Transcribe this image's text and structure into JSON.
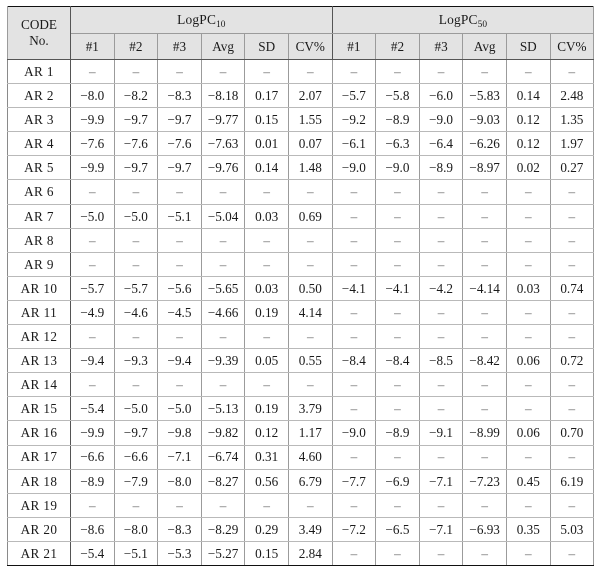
{
  "table": {
    "code_header": {
      "line1": "CODE",
      "line2": "No."
    },
    "groups": [
      {
        "label_main": "LogPC",
        "label_sub": "10"
      },
      {
        "label_main": "LogPC",
        "label_sub": "50"
      }
    ],
    "sub_headers": [
      "#1",
      "#2",
      "#3",
      "Avg",
      "SD",
      "CV%"
    ],
    "empty_marker": "–",
    "rows": [
      {
        "code": "AR 1",
        "pc10": [
          "–",
          "–",
          "–",
          "–",
          "–",
          "–"
        ],
        "pc50": [
          "–",
          "–",
          "–",
          "–",
          "–",
          "–"
        ]
      },
      {
        "code": "AR 2",
        "pc10": [
          "−8.0",
          "−8.2",
          "−8.3",
          "−8.18",
          "0.17",
          "2.07"
        ],
        "pc50": [
          "−5.7",
          "−5.8",
          "−6.0",
          "−5.83",
          "0.14",
          "2.48"
        ]
      },
      {
        "code": "AR 3",
        "pc10": [
          "−9.9",
          "−9.7",
          "−9.7",
          "−9.77",
          "0.15",
          "1.55"
        ],
        "pc50": [
          "−9.2",
          "−8.9",
          "−9.0",
          "−9.03",
          "0.12",
          "1.35"
        ]
      },
      {
        "code": "AR 4",
        "pc10": [
          "−7.6",
          "−7.6",
          "−7.6",
          "−7.63",
          "0.01",
          "0.07"
        ],
        "pc50": [
          "−6.1",
          "−6.3",
          "−6.4",
          "−6.26",
          "0.12",
          "1.97"
        ]
      },
      {
        "code": "AR 5",
        "pc10": [
          "−9.9",
          "−9.7",
          "−9.7",
          "−9.76",
          "0.14",
          "1.48"
        ],
        "pc50": [
          "−9.0",
          "−9.0",
          "−8.9",
          "−8.97",
          "0.02",
          "0.27"
        ]
      },
      {
        "code": "AR 6",
        "pc10": [
          "–",
          "–",
          "–",
          "–",
          "–",
          "–"
        ],
        "pc50": [
          "–",
          "–",
          "–",
          "–",
          "–",
          "–"
        ]
      },
      {
        "code": "AR 7",
        "pc10": [
          "−5.0",
          "−5.0",
          "−5.1",
          "−5.04",
          "0.03",
          "0.69"
        ],
        "pc50": [
          "–",
          "–",
          "–",
          "–",
          "–",
          "–"
        ]
      },
      {
        "code": "AR 8",
        "pc10": [
          "–",
          "–",
          "–",
          "–",
          "–",
          "–"
        ],
        "pc50": [
          "–",
          "–",
          "–",
          "–",
          "–",
          "–"
        ]
      },
      {
        "code": "AR 9",
        "pc10": [
          "–",
          "–",
          "–",
          "–",
          "–",
          "–"
        ],
        "pc50": [
          "–",
          "–",
          "–",
          "–",
          "–",
          "–"
        ]
      },
      {
        "code": "AR 10",
        "pc10": [
          "−5.7",
          "−5.7",
          "−5.6",
          "−5.65",
          "0.03",
          "0.50"
        ],
        "pc50": [
          "−4.1",
          "−4.1",
          "−4.2",
          "−4.14",
          "0.03",
          "0.74"
        ]
      },
      {
        "code": "AR 11",
        "pc10": [
          "−4.9",
          "−4.6",
          "−4.5",
          "−4.66",
          "0.19",
          "4.14"
        ],
        "pc50": [
          "–",
          "–",
          "–",
          "–",
          "–",
          "–"
        ]
      },
      {
        "code": "AR 12",
        "pc10": [
          "–",
          "–",
          "–",
          "–",
          "–",
          "–"
        ],
        "pc50": [
          "–",
          "–",
          "–",
          "–",
          "–",
          "–"
        ]
      },
      {
        "code": "AR 13",
        "pc10": [
          "−9.4",
          "−9.3",
          "−9.4",
          "−9.39",
          "0.05",
          "0.55"
        ],
        "pc50": [
          "−8.4",
          "−8.4",
          "−8.5",
          "−8.42",
          "0.06",
          "0.72"
        ]
      },
      {
        "code": "AR 14",
        "pc10": [
          "–",
          "–",
          "–",
          "–",
          "–",
          "–"
        ],
        "pc50": [
          "–",
          "–",
          "–",
          "–",
          "–",
          "–"
        ]
      },
      {
        "code": "AR 15",
        "pc10": [
          "−5.4",
          "−5.0",
          "−5.0",
          "−5.13",
          "0.19",
          "3.79"
        ],
        "pc50": [
          "–",
          "–",
          "–",
          "–",
          "–",
          "–"
        ]
      },
      {
        "code": "AR 16",
        "pc10": [
          "−9.9",
          "−9.7",
          "−9.8",
          "−9.82",
          "0.12",
          "1.17"
        ],
        "pc50": [
          "−9.0",
          "−8.9",
          "−9.1",
          "−8.99",
          "0.06",
          "0.70"
        ]
      },
      {
        "code": "AR 17",
        "pc10": [
          "−6.6",
          "−6.6",
          "−7.1",
          "−6.74",
          "0.31",
          "4.60"
        ],
        "pc50": [
          "–",
          "–",
          "–",
          "–",
          "–",
          "–"
        ]
      },
      {
        "code": "AR 18",
        "pc10": [
          "−8.9",
          "−7.9",
          "−8.0",
          "−8.27",
          "0.56",
          "6.79"
        ],
        "pc50": [
          "−7.7",
          "−6.9",
          "−7.1",
          "−7.23",
          "0.45",
          "6.19"
        ]
      },
      {
        "code": "AR 19",
        "pc10": [
          "–",
          "–",
          "–",
          "–",
          "–",
          "–"
        ],
        "pc50": [
          "–",
          "–",
          "–",
          "–",
          "–",
          "–"
        ]
      },
      {
        "code": "AR 20",
        "pc10": [
          "−8.6",
          "−8.0",
          "−8.3",
          "−8.29",
          "0.29",
          "3.49"
        ],
        "pc50": [
          "−7.2",
          "−6.5",
          "−7.1",
          "−6.93",
          "0.35",
          "5.03"
        ]
      },
      {
        "code": "AR 21",
        "pc10": [
          "−5.4",
          "−5.1",
          "−5.3",
          "−5.27",
          "0.15",
          "2.84"
        ],
        "pc50": [
          "–",
          "–",
          "–",
          "–",
          "–",
          "–"
        ]
      }
    ]
  }
}
